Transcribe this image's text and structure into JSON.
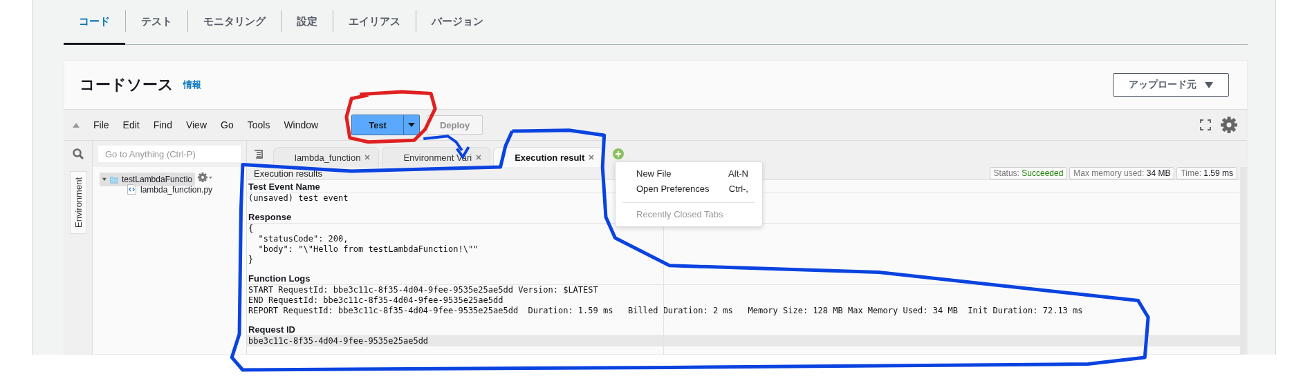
{
  "top_tabs": [
    {
      "label": "コード",
      "selected": true
    },
    {
      "label": "テスト",
      "selected": false
    },
    {
      "label": "モニタリング",
      "selected": false
    },
    {
      "label": "設定",
      "selected": false
    },
    {
      "label": "エイリアス",
      "selected": false
    },
    {
      "label": "バージョン",
      "selected": false
    }
  ],
  "code_source": {
    "title": "コードソース",
    "info_link": "情報",
    "upload_button": "アップロード元"
  },
  "toolbar": {
    "menu": [
      "File",
      "Edit",
      "Find",
      "View",
      "Go",
      "Tools",
      "Window"
    ],
    "test_button": "Test",
    "deploy_button": {
      "label": "Deploy",
      "disabled": true
    }
  },
  "search": {
    "placeholder": "Go to Anything (Ctrl-P)"
  },
  "side_tab": "Environment",
  "file_tree": [
    {
      "name": "testLambdaFunctio",
      "expanded": true,
      "children": [
        {
          "name": "lambda_function.py"
        }
      ]
    }
  ],
  "editor_tabs": [
    {
      "label": "lambda_function",
      "selected": false
    },
    {
      "label": "Environment Vari",
      "selected": false
    },
    {
      "label": "Execution result",
      "selected": true
    }
  ],
  "results_panel": {
    "title": "Execution results",
    "badges": [
      {
        "label": "Status:",
        "value": "Succeeded",
        "kind": "status"
      },
      {
        "label": "Max memory used:",
        "value": "34 MB",
        "kind": "metric"
      },
      {
        "label": "Time:",
        "value": "1.59 ms",
        "kind": "metric"
      }
    ]
  },
  "sections": [
    {
      "heading": "Test Event Name",
      "lines": [
        "(unsaved) test event"
      ],
      "highlighted": false
    },
    {
      "heading": "Response",
      "lines": [
        "{",
        "  \"statusCode\": 200,",
        "  \"body\": \"\\\"Hello from testLambdaFunction!\\\"\"",
        "}"
      ],
      "highlighted": false
    },
    {
      "heading": "Function Logs",
      "lines": [
        "START RequestId: bbe3c11c-8f35-4d04-9fee-9535e25ae5dd Version: $LATEST",
        "END RequestId: bbe3c11c-8f35-4d04-9fee-9535e25ae5dd",
        "REPORT RequestId: bbe3c11c-8f35-4d04-9fee-9535e25ae5dd  Duration: 1.59 ms   Billed Duration: 2 ms   Memory Size: 128 MB Max Memory Used: 34 MB  Init Duration: 72.13 ms"
      ],
      "highlighted": false
    },
    {
      "heading": "Request ID",
      "lines": [
        "bbe3c11c-8f35-4d04-9fee-9535e25ae5dd"
      ],
      "highlighted": true
    }
  ],
  "context_menu": [
    {
      "label": "New File",
      "shortcut": "Alt-N",
      "kind": "command"
    },
    {
      "label": "Open Preferences",
      "shortcut": "Ctrl-,",
      "kind": "command"
    },
    {
      "label": "Recently Closed Tabs",
      "kind": "section"
    }
  ]
}
